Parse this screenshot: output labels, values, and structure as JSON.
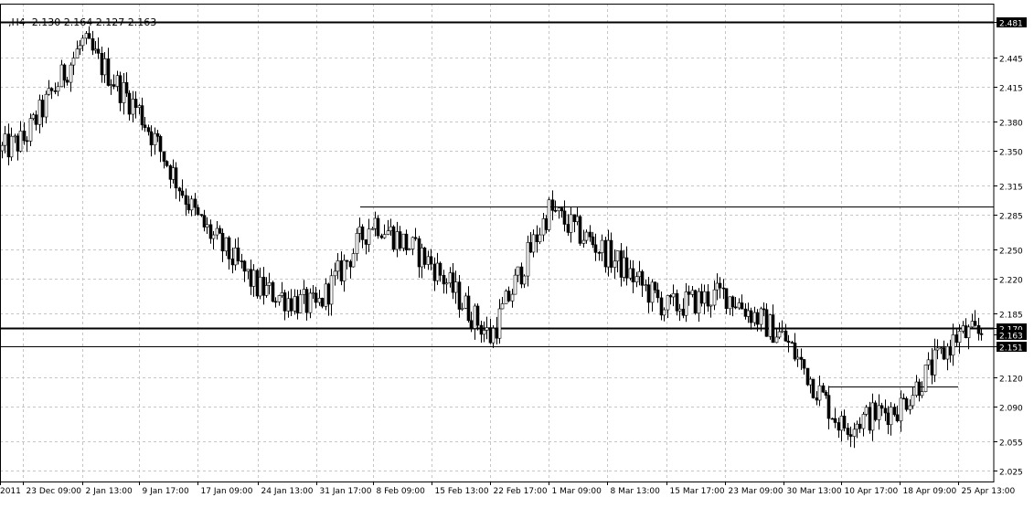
{
  "header": {
    "symbol_period": ",H4",
    "quote": "2.130 2.164 2.127 2.163"
  },
  "chart_data": {
    "type": "candlestick",
    "title": "",
    "xlabel": "",
    "ylabel": "",
    "ylim": [
      2.0137,
      2.4996
    ],
    "grid": true,
    "y_ticks": [
      "2.481",
      "2.445",
      "2.415",
      "2.380",
      "2.350",
      "2.315",
      "2.285",
      "2.250",
      "2.220",
      "2.185",
      "2.170",
      "2.163",
      "2.151",
      "2.120",
      "2.090",
      "2.055",
      "2.025"
    ],
    "x_ticks": [
      "2011",
      "23 Dec 09:00",
      "2 Jan 13:00",
      "9 Jan 17:00",
      "17 Jan 09:00",
      "24 Jan 13:00",
      "31 Jan 17:00",
      "8 Feb 09:00",
      "15 Feb 13:00",
      "22 Feb 17:00",
      "1 Mar 09:00",
      "8 Mar 13:00",
      "15 Mar 17:00",
      "23 Mar 09:00",
      "30 Mar 13:00",
      "10 Apr 17:00",
      "18 Apr 09:00",
      "25 Apr 13:00"
    ],
    "highlighted_levels": [
      "2.481",
      "2.170",
      "2.163",
      "2.151"
    ],
    "horizontal_lines": [
      {
        "price": 2.481,
        "style": "thick",
        "full_width": true
      },
      {
        "price": 2.17,
        "style": "thick",
        "full_width": true
      },
      {
        "price": 2.151,
        "style": "thin",
        "full_width": true
      }
    ],
    "segments": [
      {
        "price": 2.293,
        "from_label": "8 Feb 09:00",
        "to_label": "end"
      },
      {
        "price": 2.11,
        "from_label": "10 Apr 17:00",
        "to_label": "25 Apr 13:00"
      }
    ],
    "close_price": 2.163,
    "close_trace": [
      [
        "2011",
        2.35
      ],
      [
        "23 Dec 09:00",
        2.36
      ],
      [
        "2 Jan 13:00",
        2.46
      ],
      [
        "9 Jan 17:00",
        2.39
      ],
      [
        "17 Jan 09:00",
        2.28
      ],
      [
        "24 Jan 13:00",
        2.21
      ],
      [
        "31 Jan 17:00",
        2.19
      ],
      [
        "8 Feb 09:00",
        2.28
      ],
      [
        "15 Feb 13:00",
        2.235
      ],
      [
        "22 Feb 17:00",
        2.16
      ],
      [
        "1 Mar 09:00",
        2.29
      ],
      [
        "8 Mar 13:00",
        2.245
      ],
      [
        "15 Mar 17:00",
        2.19
      ],
      [
        "23 Mar 09:00",
        2.205
      ],
      [
        "30 Mar 13:00",
        2.16
      ],
      [
        "10 Apr 17:00",
        2.07
      ],
      [
        "18 Apr 09:00",
        2.09
      ],
      [
        "25 Apr 13:00",
        2.163
      ]
    ]
  }
}
